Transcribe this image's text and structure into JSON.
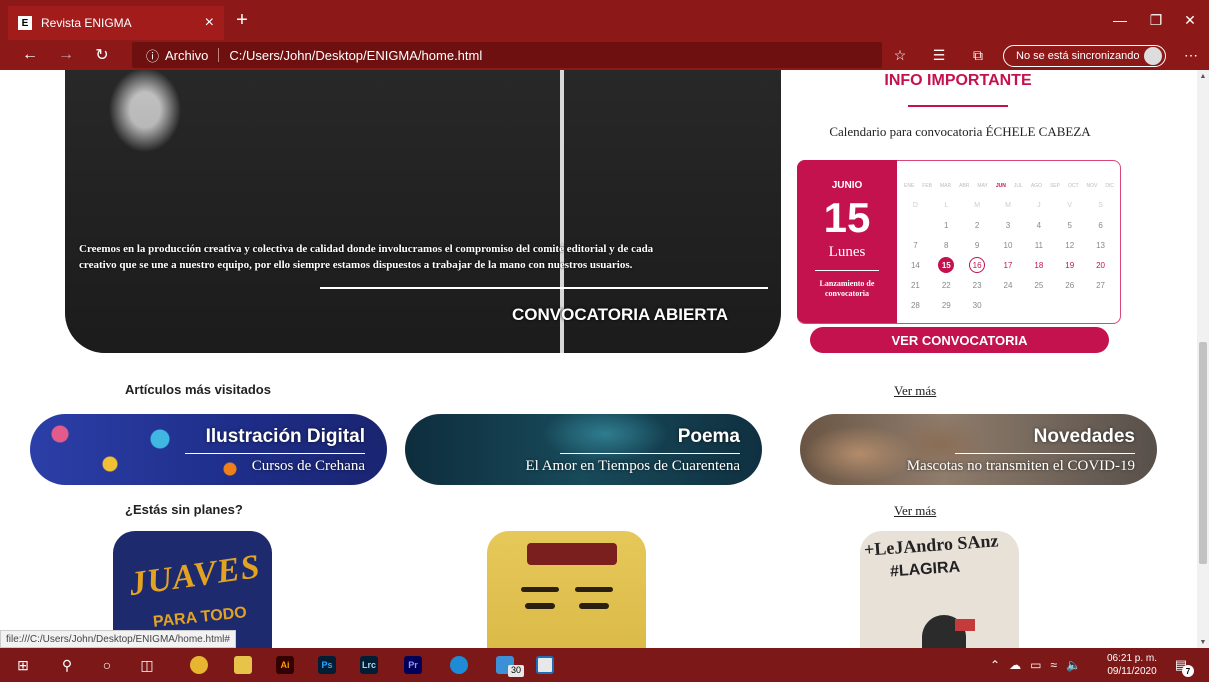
{
  "browser": {
    "tab_title": "Revista ENIGMA",
    "tab_favicon": "E",
    "tab_close": "×",
    "new_tab": "+",
    "address_label": "Archivo",
    "url": "C:/Users/John/Desktop/ENIGMA/home.html",
    "sync_label": "No se está sincronizando",
    "status_url": "file:///C:/Users/John/Desktop/ENIGMA/home.html#"
  },
  "hero": {
    "text": "Creemos en la producción creativa y colectiva de calidad donde involucramos el compromiso del comité editorial y de cada creativo que se une a nuestro equipo, por ello siempre estamos dispuestos a trabajar de la mano con nuestros usuarios.",
    "cta": "CONVOCATORIA ABIERTA"
  },
  "info": {
    "title": "INFO IMPORTANTE",
    "subtitle": "Calendario para convocatoria ÉCHELE CABEZA",
    "button": "VER CONVOCATORIA"
  },
  "calendar": {
    "month": "JUNIO",
    "day": "15",
    "weekday": "Lunes",
    "note": "Lanzamiento de convocatoria",
    "months": [
      "ENE",
      "FEB",
      "MAR",
      "ABR",
      "MAY",
      "JUN",
      "JUL",
      "AGO",
      "SEP",
      "OCT",
      "NOV",
      "DIC"
    ],
    "weekday_headers": [
      "D",
      "L",
      "M",
      "M",
      "J",
      "V",
      "S"
    ],
    "days": [
      "1",
      "2",
      "3",
      "4",
      "5",
      "6",
      "7",
      "8",
      "9",
      "10",
      "11",
      "12",
      "13",
      "14",
      "15",
      "16",
      "17",
      "18",
      "19",
      "20",
      "21",
      "22",
      "23",
      "24",
      "25",
      "26",
      "27",
      "28",
      "29",
      "30"
    ]
  },
  "sections": {
    "visited_title": "Artículos más visitados",
    "plans_title": "¿Estás sin planes?",
    "see_more": "Ver más"
  },
  "articles": [
    {
      "title": "Ilustración Digital",
      "subtitle": "Cursos de Crehana"
    },
    {
      "title": "Poema",
      "subtitle": "El Amor en Tiempos de Cuarentena"
    },
    {
      "title": "Novedades",
      "subtitle": "Mascotas no transmiten el COVID-19"
    }
  ],
  "taskbar": {
    "time": "06:21 p. m.",
    "date": "09/11/2020",
    "edge_badge": "30",
    "notif_count": "7",
    "apps": [
      "Ai",
      "Ps",
      "Lrc",
      "Pr"
    ]
  },
  "colors": {
    "brand": "#c4124e",
    "chrome": "#8c1818"
  }
}
